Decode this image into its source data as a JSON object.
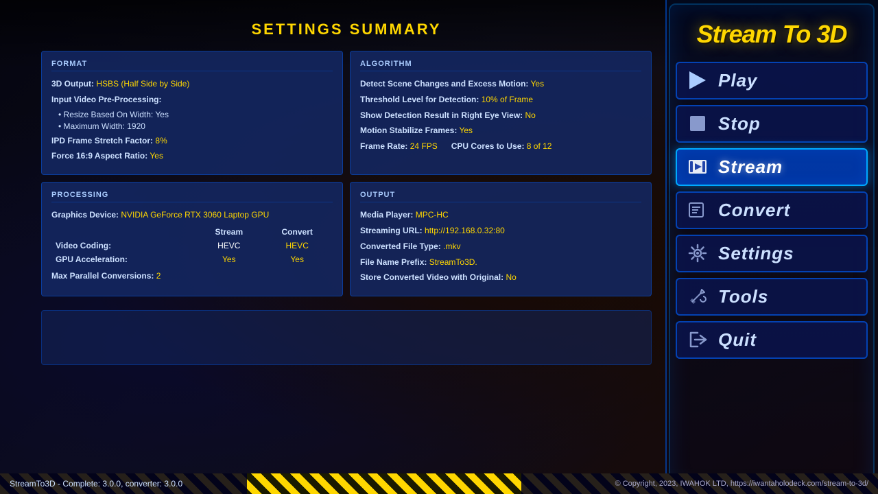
{
  "app": {
    "title": "Stream To 3D",
    "title_line1": "Stream To 3D"
  },
  "settings_summary": {
    "title": "SETTINGS SUMMARY"
  },
  "format_card": {
    "title": "FORMAT",
    "output_label": "3D Output:",
    "output_value": "HSBS (Half Side by Side)",
    "preprocessing_label": "Input Video Pre-Processing:",
    "bullet1_label": "Resize Based On Width:",
    "bullet1_value": "Yes",
    "bullet2_label": "Maximum Width:",
    "bullet2_value": "1920",
    "ipd_label": "IPD Frame Stretch Factor:",
    "ipd_value": "8%",
    "force_label": "Force 16:9 Aspect Ratio:",
    "force_value": "Yes"
  },
  "algorithm_card": {
    "title": "ALGORITHM",
    "detect_label": "Detect Scene Changes and Excess Motion:",
    "detect_value": "Yes",
    "threshold_label": "Threshold Level for Detection:",
    "threshold_value": "10% of Frame",
    "show_label": "Show Detection Result in Right Eye View:",
    "show_value": "No",
    "motion_label": "Motion Stabilize Frames:",
    "motion_value": "Yes",
    "framerate_label": "Frame Rate:",
    "framerate_value": "24 FPS",
    "cores_label": "CPU Cores to Use:",
    "cores_value": "8 of 12"
  },
  "processing_card": {
    "title": "PROCESSING",
    "device_label": "Graphics Device:",
    "device_value": "NVIDIA GeForce RTX 3060 Laptop GPU",
    "col_stream": "Stream",
    "col_convert": "Convert",
    "video_coding_label": "Video Coding:",
    "stream_video": "HEVC",
    "convert_video": "HEVC",
    "gpu_accel_label": "GPU Acceleration:",
    "stream_gpu": "Yes",
    "convert_gpu": "Yes",
    "max_parallel_label": "Max Parallel Conversions:",
    "max_parallel_value": "2"
  },
  "output_card": {
    "title": "OUTPUT",
    "media_player_label": "Media Player:",
    "media_player_value": "MPC-HC",
    "streaming_url_label": "Streaming URL:",
    "streaming_url_value": "http://192.168.0.32:80",
    "converted_type_label": "Converted File Type:",
    "converted_type_value": ".mkv",
    "filename_prefix_label": "File Name Prefix:",
    "filename_prefix_value": "StreamTo3D.",
    "store_label": "Store Converted Video with Original:",
    "store_value": "No"
  },
  "nav": {
    "play_label": "Play",
    "stop_label": "Stop",
    "stream_label": "Stream",
    "convert_label": "Convert",
    "settings_label": "Settings",
    "tools_label": "Tools",
    "quit_label": "Quit"
  },
  "status_bar": {
    "left_text": "StreamTo3D - Complete: 3.0.0, converter: 3.0.0",
    "right_text": "© Copyright, 2023, IWAHOK LTD, https://iwantaholodeck.com/stream-to-3d/"
  }
}
